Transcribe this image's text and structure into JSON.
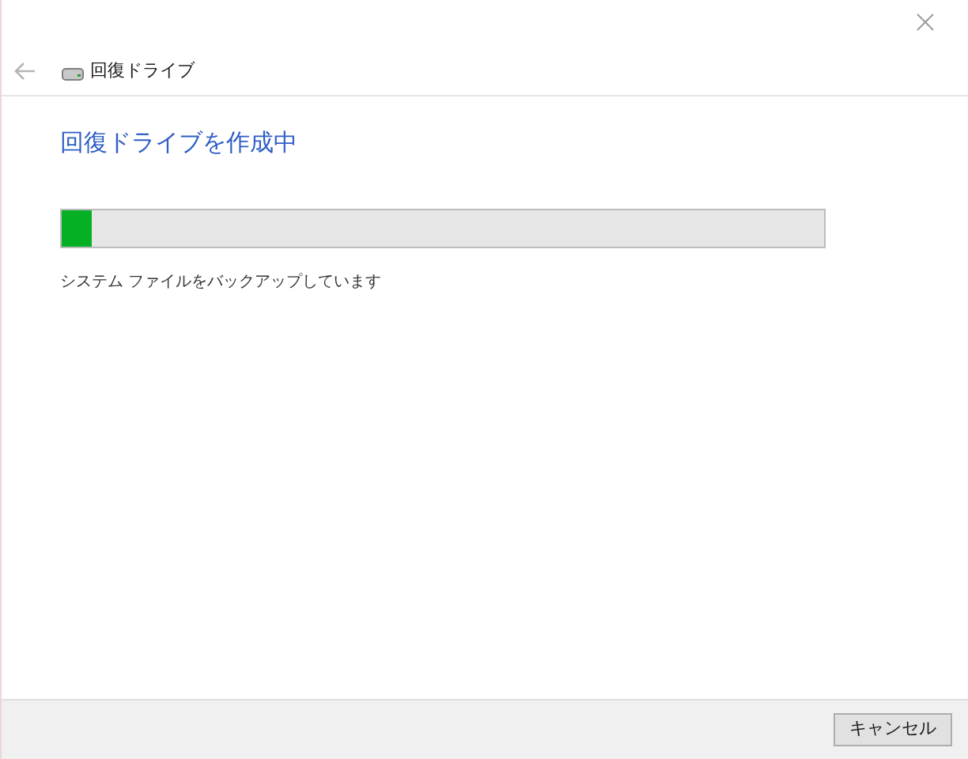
{
  "nav": {
    "title": "回復ドライブ",
    "back_disabled": true
  },
  "heading": "回復ドライブを作成中",
  "progress": {
    "level": 0.04
  },
  "status": "システム ファイルをバックアップしています",
  "buttons": [
    "キャンセル"
  ]
}
